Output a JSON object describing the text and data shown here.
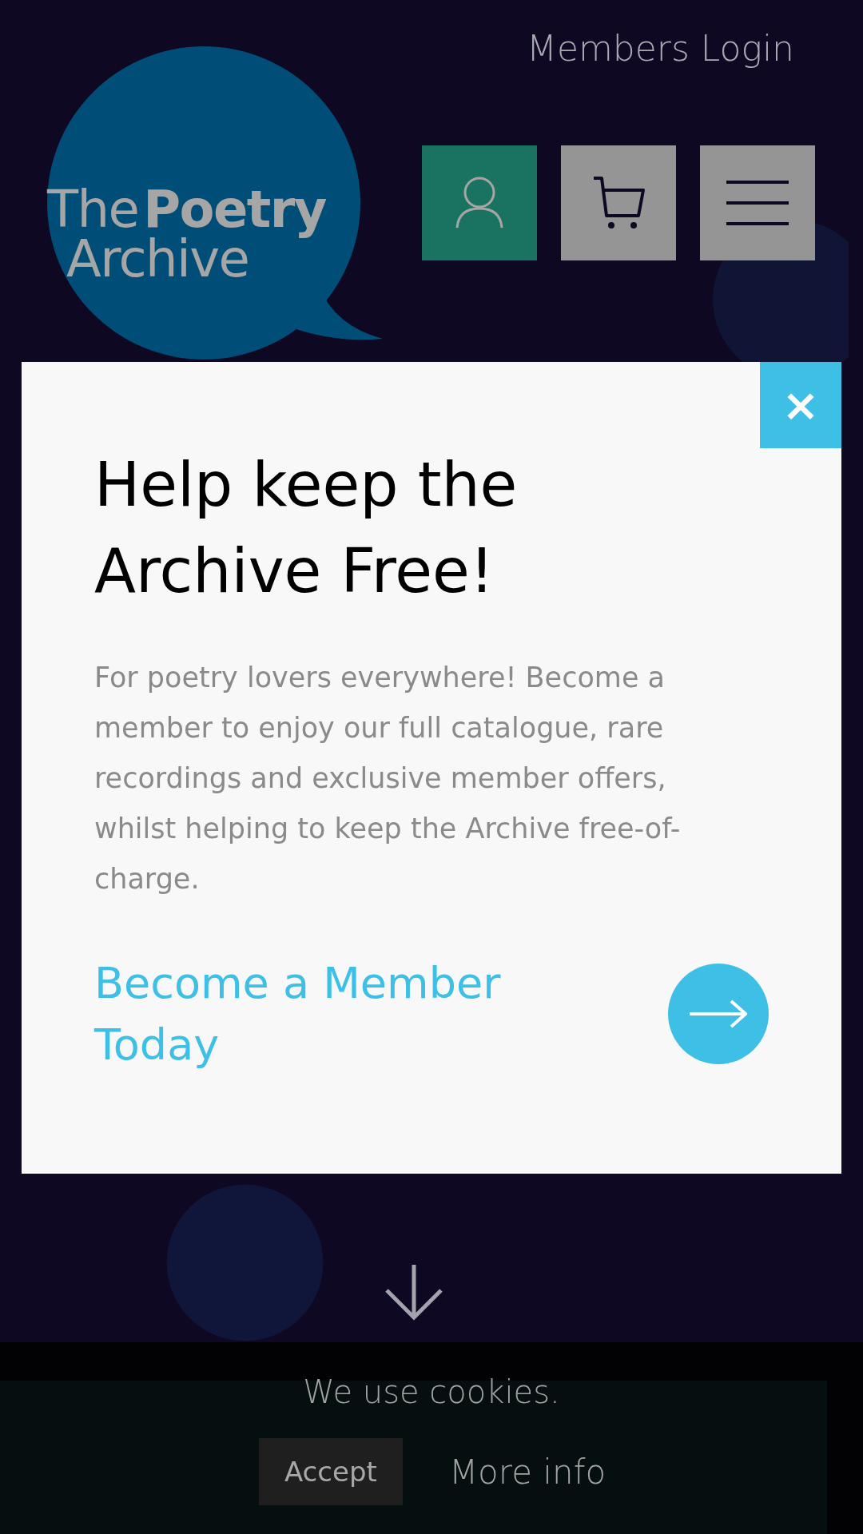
{
  "header": {
    "login_link": "Members Login",
    "logo": {
      "line_1_light": "The",
      "line_1_bold": "Poetry",
      "line_2": "Archive"
    }
  },
  "modal": {
    "close_label": "×",
    "title": "Help keep the Archive Free!",
    "body": "For poetry lovers everywhere! Become a member to enjoy our full catalogue, rare recordings and exclusive member offers, whilst helping to keep the Archive free-of-charge.",
    "cta": "Become a Member Today"
  },
  "cookie_bar": {
    "message": "We use cookies.",
    "accept": "Accept",
    "more_info": "More info"
  }
}
